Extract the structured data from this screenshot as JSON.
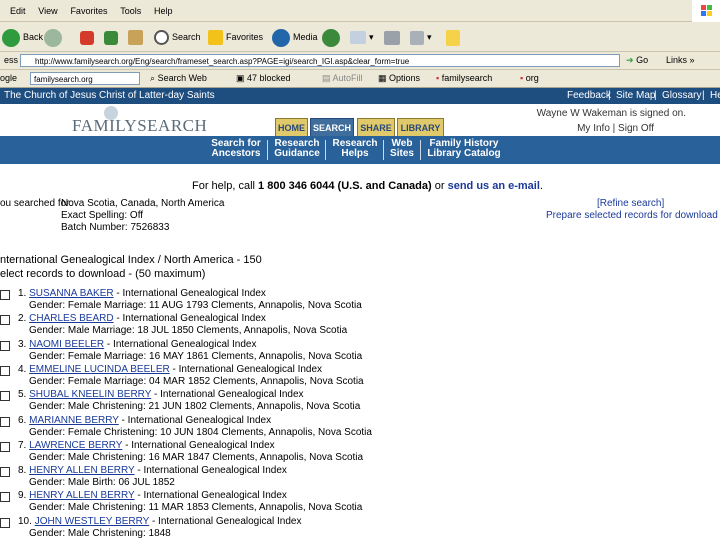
{
  "browser": {
    "menu": [
      "Edit",
      "View",
      "Favorites",
      "Tools",
      "Help"
    ],
    "toolbar": {
      "back": "Back",
      "search": "Search",
      "favorites": "Favorites",
      "media": "Media"
    },
    "address_label": "ess",
    "address": "http://www.familysearch.org/Eng/search/frameset_search.asp?PAGE=igi/search_IGI.asp&clear_form=true",
    "go": "Go",
    "links": "Links"
  },
  "google_toolbar": {
    "label": "ogle",
    "search_value": "familysearch.org",
    "items": [
      "Search Web",
      "47 blocked",
      "AutoFill",
      "Options",
      "familysearch",
      "org"
    ]
  },
  "site": {
    "church": "The Church of Jesus Christ of Latter-day Saints",
    "top_links": [
      "Feedback",
      "Site Map",
      "Glossary",
      "He"
    ],
    "logo": "FAMILYSEARCH",
    "tabs": [
      "HOME",
      "SEARCH",
      "SHARE",
      "LIBRARY"
    ],
    "active_tab": "SEARCH",
    "signed_on": "Wayne W Wakeman is signed on.",
    "account_links": [
      "My Info",
      "Sign Off"
    ],
    "nav": [
      {
        "l1": "Search for",
        "l2": "Ancestors"
      },
      {
        "l1": "Research",
        "l2": "Guidance"
      },
      {
        "l1": "Research",
        "l2": "Helps"
      },
      {
        "l1": "Web",
        "l2": "Sites"
      },
      {
        "l1": "Family History",
        "l2": "Library Catalog"
      }
    ]
  },
  "help": {
    "prefix": "For help, call ",
    "phone": "1 800 346 6044 (U.S. and Canada)",
    "middle": " or ",
    "link": "send us an e-mail",
    "suffix": "."
  },
  "search": {
    "label": "ou searched for:",
    "criteria": [
      "Nova Scotia, Canada, North America",
      "Exact Spelling: Off",
      "Batch Number: 7526833"
    ],
    "refine": "[Refine search]",
    "prepare": "Prepare selected records for download"
  },
  "results": {
    "title": "nternational Genealogical Index / North America - 150",
    "select_note": "elect records to download - (50 maximum)",
    "records": [
      {
        "num": "1.",
        "name": "SUSANNA BAKER",
        "source": " - International Genealogical Index",
        "detail": "Gender: Female Marriage: 11 AUG 1793 Clements, Annapolis, Nova Scotia"
      },
      {
        "num": "2.",
        "name": "CHARLES BEARD",
        "source": " - International Genealogical Index",
        "detail": "Gender: Male Marriage: 18 JUL 1850 Clements, Annapolis, Nova Scotia"
      },
      {
        "num": "3.",
        "name": "NAOMI BEELER",
        "source": " - International Genealogical Index",
        "detail": "Gender: Female Marriage: 16 MAY 1861 Clements, Annapolis, Nova Scotia"
      },
      {
        "num": "4.",
        "name": "EMMELINE LUCINDA BEELER",
        "source": " - International Genealogical Index",
        "detail": "Gender: Female Marriage: 04 MAR 1852 Clements, Annapolis, Nova Scotia"
      },
      {
        "num": "5.",
        "name": "SHUBAL KNEELIN BERRY",
        "source": " - International Genealogical Index",
        "detail": "Gender: Male Christening: 21 JUN 1802 Clements, Annapolis, Nova Scotia"
      },
      {
        "num": "6.",
        "name": "MARIANNE BERRY",
        "source": " - International Genealogical Index",
        "detail": "Gender: Female Christening: 10 JUN 1804 Clements, Annapolis, Nova Scotia"
      },
      {
        "num": "7.",
        "name": "LAWRENCE BERRY",
        "source": " - International Genealogical Index",
        "detail": "Gender: Male Christening: 16 MAR 1847 Clements, Annapolis, Nova Scotia"
      },
      {
        "num": "8.",
        "name": "HENRY ALLEN BERRY",
        "source": " - International Genealogical Index",
        "detail": "Gender: Male Birth: 06 JUL 1852"
      },
      {
        "num": "9.",
        "name": "HENRY ALLEN BERRY",
        "source": " - International Genealogical Index",
        "detail": "Gender: Male Christening: 11 MAR 1853 Clements, Annapolis, Nova Scotia"
      },
      {
        "num": "10.",
        "name": "JOHN WESTLEY BERRY",
        "source": " - International Genealogical Index",
        "detail": "Gender: Male Christening: 1848"
      }
    ]
  }
}
